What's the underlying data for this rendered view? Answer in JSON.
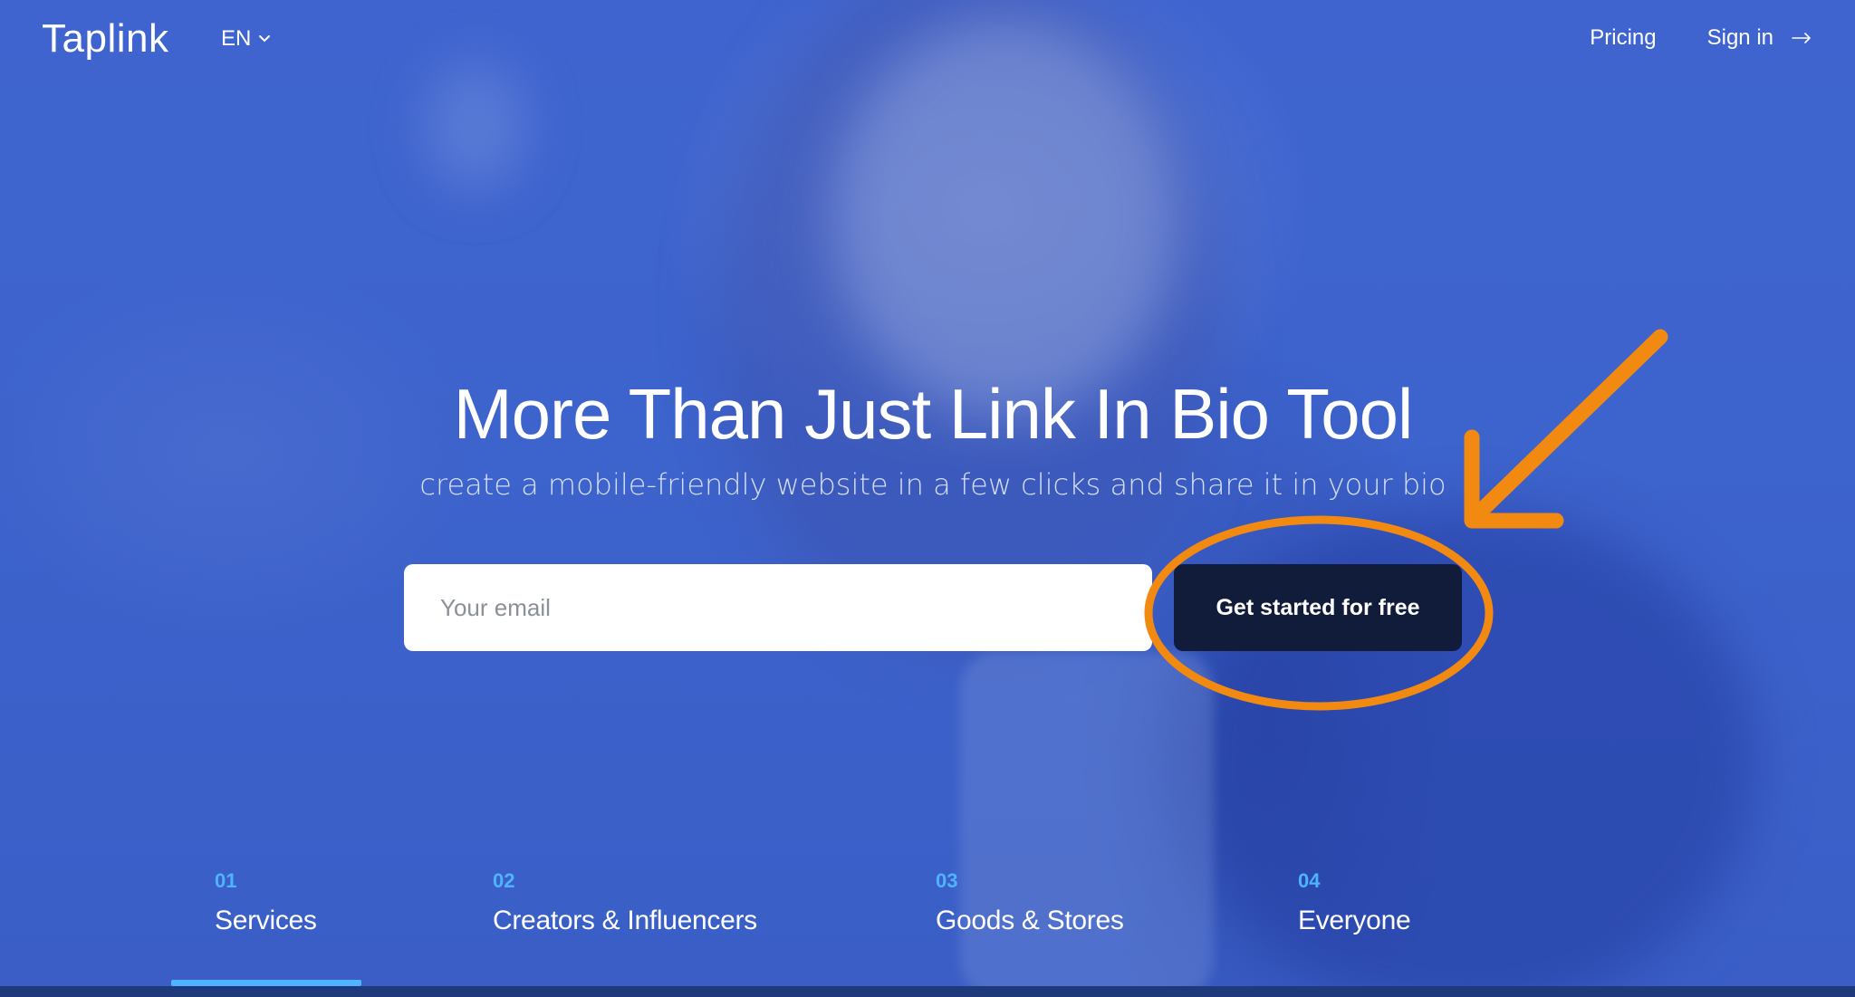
{
  "brand": {
    "logo": "Taplink"
  },
  "header": {
    "language": "EN",
    "nav": {
      "pricing": "Pricing",
      "sign_in": "Sign in"
    }
  },
  "hero": {
    "title": "More Than Just Link In Bio Tool",
    "subtitle": "create a mobile-friendly website in a few clicks and share it in your bio",
    "email_placeholder": "Your email",
    "cta_label": "Get started for free"
  },
  "annotation": {
    "color": "#f28a12"
  },
  "tabs": [
    {
      "number": "01",
      "label": "Services",
      "active": true
    },
    {
      "number": "02",
      "label": "Creators & Influencers",
      "active": false
    },
    {
      "number": "03",
      "label": "Goods & Stores",
      "active": false
    },
    {
      "number": "04",
      "label": "Everyone",
      "active": false
    }
  ],
  "colors": {
    "background": "#3d63cc",
    "cta": "#111c3a",
    "accent": "#4fb3ff"
  }
}
